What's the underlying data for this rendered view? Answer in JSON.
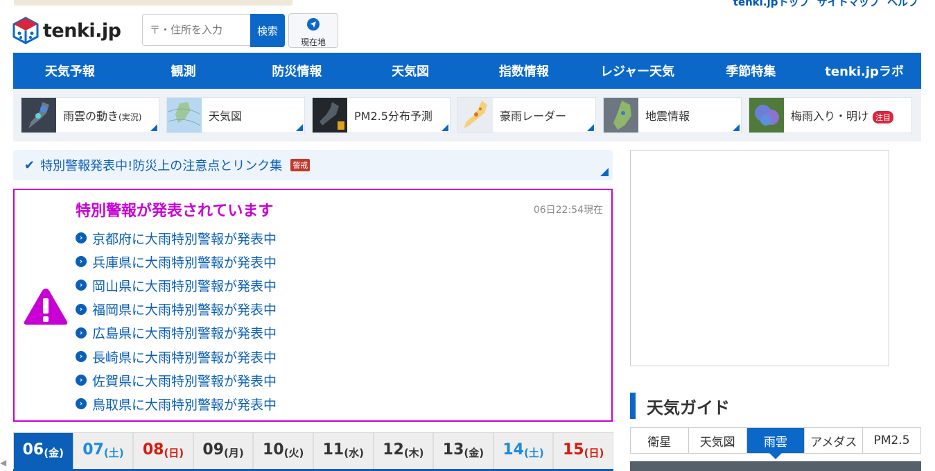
{
  "header": {
    "logo_text": "tenki.jp",
    "top_links": [
      "tenki.jpトップ",
      "サイトマップ",
      "ヘルプ"
    ],
    "search_placeholder": "〒・住所を入力",
    "search_button": "検索",
    "location_button": "現在地"
  },
  "nav": [
    "天気予報",
    "観測",
    "防災情報",
    "天気図",
    "指数情報",
    "レジャー天気",
    "季節特集",
    "tenki.jpラボ"
  ],
  "quick_links": [
    {
      "label": "雨雲の動き",
      "sub": "(実況)",
      "thumb": "radar-map-thumb"
    },
    {
      "label": "天気図",
      "sub": "",
      "thumb": "weather-chart-thumb"
    },
    {
      "label": "PM2.5分布予測",
      "sub": "",
      "thumb": "pm25-map-thumb"
    },
    {
      "label": "豪雨レーダー",
      "sub": "",
      "thumb": "heavy-rain-radar-thumb"
    },
    {
      "label": "地震情報",
      "sub": "",
      "thumb": "earthquake-map-thumb"
    },
    {
      "label": "梅雨入り・明け",
      "sub": "",
      "badge": "注目",
      "thumb": "hydrangea-thumb"
    }
  ],
  "alert_bar": {
    "text": "特別警報発表中!防災上の注意点とリンク集",
    "badge": "警戒"
  },
  "warning": {
    "title": "特別警報が発表されています",
    "time": "06日22:54現在",
    "items": [
      "京都府に大雨特別警報が発表中",
      "兵庫県に大雨特別警報が発表中",
      "岡山県に大雨特別警報が発表中",
      "福岡県に大雨特別警報が発表中",
      "広島県に大雨特別警報が発表中",
      "長崎県に大雨特別警報が発表中",
      "佐賀県に大雨特別警報が発表中",
      "鳥取県に大雨特別警報が発表中"
    ]
  },
  "days": [
    {
      "num": "06",
      "dow": "(金)",
      "kind": "active"
    },
    {
      "num": "07",
      "dow": "(土)",
      "kind": "sat"
    },
    {
      "num": "08",
      "dow": "(日)",
      "kind": "sun"
    },
    {
      "num": "09",
      "dow": "(月)",
      "kind": ""
    },
    {
      "num": "10",
      "dow": "(火)",
      "kind": ""
    },
    {
      "num": "11",
      "dow": "(水)",
      "kind": ""
    },
    {
      "num": "12",
      "dow": "(木)",
      "kind": ""
    },
    {
      "num": "13",
      "dow": "(金)",
      "kind": ""
    },
    {
      "num": "14",
      "dow": "(土)",
      "kind": "sat"
    },
    {
      "num": "15",
      "dow": "(日)",
      "kind": "sun"
    }
  ],
  "guide": {
    "title": "天気ガイド",
    "tabs": [
      "衛星",
      "天気図",
      "雨雲",
      "アメダス",
      "PM2.5"
    ],
    "active_tab": "雨雲"
  },
  "colors": {
    "brand_blue": "#0b68c9",
    "warning_purple": "#c800d6",
    "link_blue": "#0b5fb8"
  }
}
